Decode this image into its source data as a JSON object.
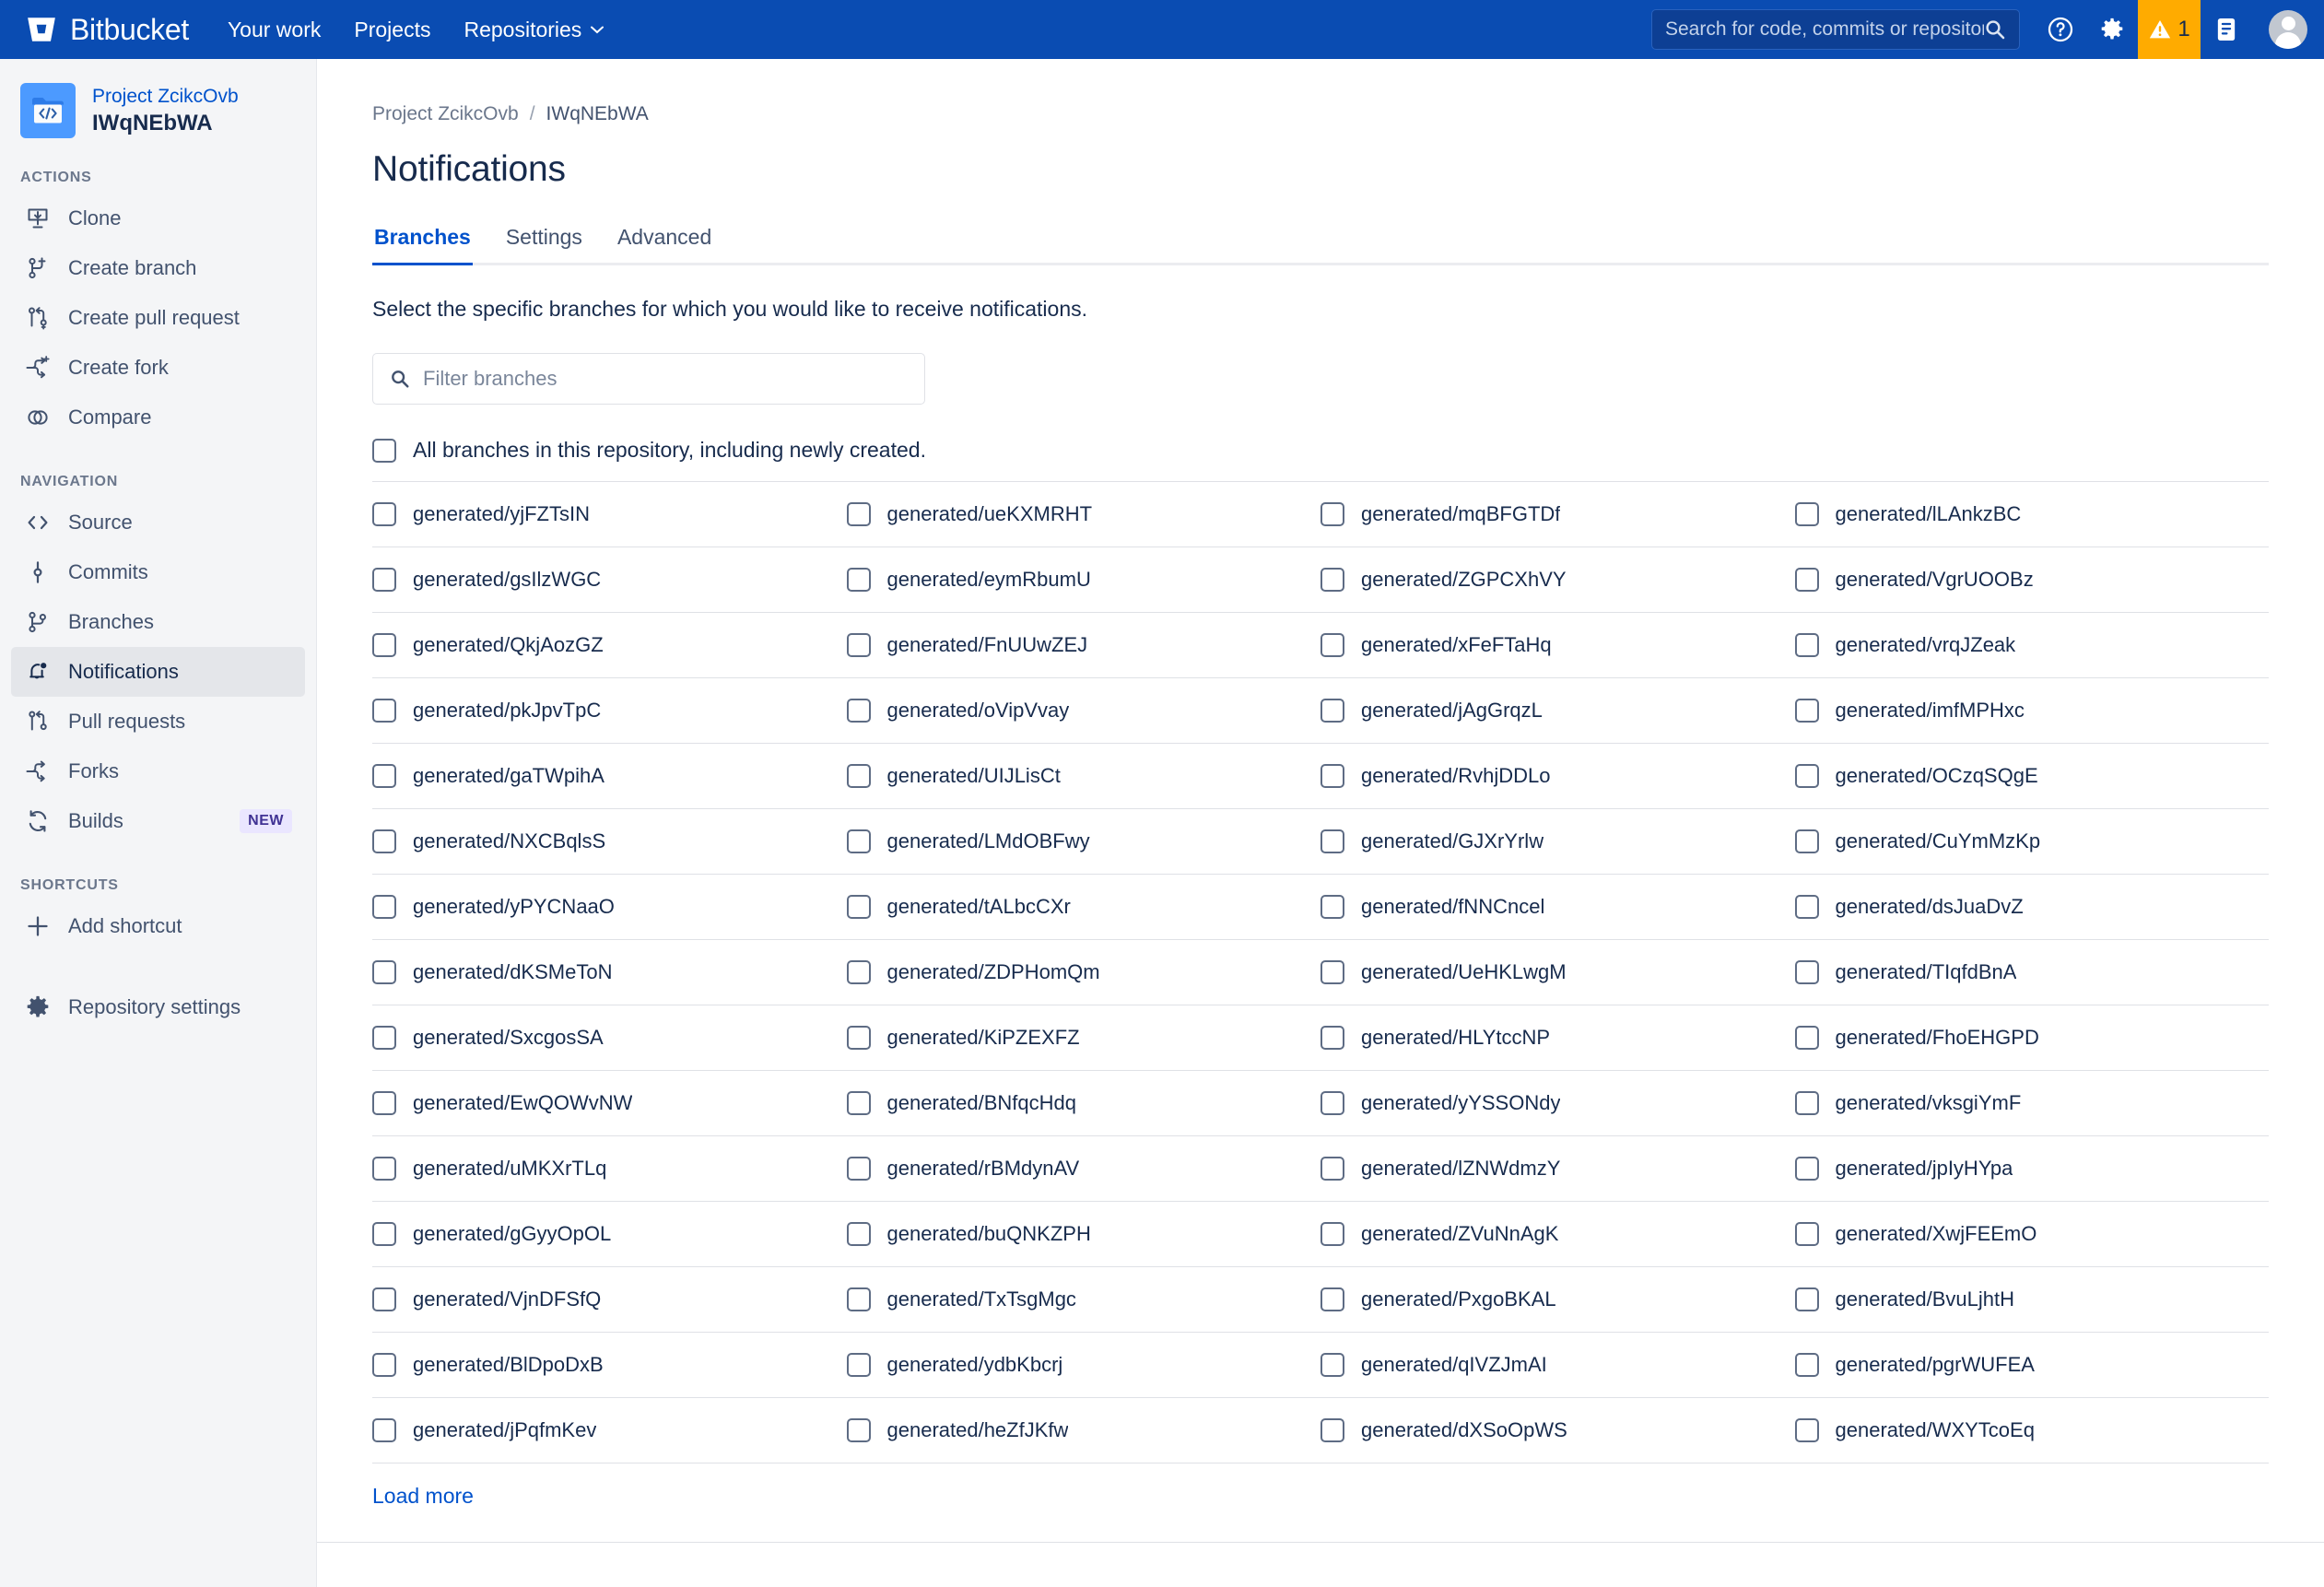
{
  "topnav": {
    "brand": "Bitbucket",
    "links": [
      {
        "label": "Your work",
        "has_chevron": false
      },
      {
        "label": "Projects",
        "has_chevron": false
      },
      {
        "label": "Repositories",
        "has_chevron": true
      }
    ],
    "search_placeholder": "Search for code, commits or repositories...",
    "notification_count": "1",
    "icons": [
      "search-icon",
      "help-icon",
      "gear-icon",
      "warning-icon",
      "notepad-icon",
      "avatar"
    ],
    "colors": {
      "bar": "#0A4CB2",
      "warning_badge": "#FFAB00"
    }
  },
  "sidebar": {
    "project_link": "Project ZcikcOvb",
    "repo_name": "IWqNEbWA",
    "sections": [
      {
        "label": "ACTIONS",
        "items": [
          {
            "label": "Clone",
            "icon": "clone-icon"
          },
          {
            "label": "Create branch",
            "icon": "create-branch-icon"
          },
          {
            "label": "Create pull request",
            "icon": "create-pull-request-icon"
          },
          {
            "label": "Create fork",
            "icon": "create-fork-icon"
          },
          {
            "label": "Compare",
            "icon": "compare-icon"
          }
        ]
      },
      {
        "label": "NAVIGATION",
        "items": [
          {
            "label": "Source",
            "icon": "source-icon"
          },
          {
            "label": "Commits",
            "icon": "commits-icon"
          },
          {
            "label": "Branches",
            "icon": "branches-icon"
          },
          {
            "label": "Notifications",
            "icon": "notifications-icon",
            "active": true
          },
          {
            "label": "Pull requests",
            "icon": "pull-requests-icon"
          },
          {
            "label": "Forks",
            "icon": "forks-icon"
          },
          {
            "label": "Builds",
            "icon": "builds-icon",
            "badge": "NEW"
          }
        ]
      },
      {
        "label": "SHORTCUTS",
        "items": [
          {
            "label": "Add shortcut",
            "icon": "plus-icon"
          }
        ]
      }
    ],
    "repository_settings": {
      "label": "Repository settings",
      "icon": "gear-icon"
    }
  },
  "main": {
    "breadcrumb": {
      "project": "Project ZcikcOvb",
      "separator": "/",
      "repo": "IWqNEbWA"
    },
    "title": "Notifications",
    "tabs": [
      {
        "label": "Branches",
        "active": true
      },
      {
        "label": "Settings",
        "active": false
      },
      {
        "label": "Advanced",
        "active": false
      }
    ],
    "lead": "Select the specific branches for which you would like to receive notifications.",
    "filter_placeholder": "Filter branches",
    "filter_value": "",
    "all_branches_label": "All branches in this repository, including newly created.",
    "all_branches_checked": false,
    "load_more_label": "Load more",
    "branches": [
      "generated/yjFZTsIN",
      "generated/ueKXMRHT",
      "generated/mqBFGTDf",
      "generated/lLAnkzBC",
      "generated/gsIlzWGC",
      "generated/eymRbumU",
      "generated/ZGPCXhVY",
      "generated/VgrUOOBz",
      "generated/QkjAozGZ",
      "generated/FnUUwZEJ",
      "generated/xFeFTaHq",
      "generated/vrqJZeak",
      "generated/pkJpvTpC",
      "generated/oVipVvay",
      "generated/jAgGrqzL",
      "generated/imfMPHxc",
      "generated/gaTWpihA",
      "generated/UIJLisCt",
      "generated/RvhjDDLo",
      "generated/OCzqSQgE",
      "generated/NXCBqlsS",
      "generated/LMdOBFwy",
      "generated/GJXrYrlw",
      "generated/CuYmMzKp",
      "generated/yPYCNaaO",
      "generated/tALbcCXr",
      "generated/fNNCncel",
      "generated/dsJuaDvZ",
      "generated/dKSMeToN",
      "generated/ZDPHomQm",
      "generated/UeHKLwgM",
      "generated/TIqfdBnA",
      "generated/SxcgosSA",
      "generated/KiPZEXFZ",
      "generated/HLYtccNP",
      "generated/FhoEHGPD",
      "generated/EwQOWvNW",
      "generated/BNfqcHdq",
      "generated/yYSSONdy",
      "generated/vksgiYmF",
      "generated/uMKXrTLq",
      "generated/rBMdynAV",
      "generated/lZNWdmzY",
      "generated/jpIyHYpa",
      "generated/gGyyOpOL",
      "generated/buQNKZPH",
      "generated/ZVuNnAgK",
      "generated/XwjFEEmO",
      "generated/VjnDFSfQ",
      "generated/TxTsgMgc",
      "generated/PxgoBKAL",
      "generated/BvuLjhtH",
      "generated/BlDpoDxB",
      "generated/ydbKbcrj",
      "generated/qIVZJmAI",
      "generated/pgrWUFEA",
      "generated/jPqfmKev",
      "generated/heZfJKfw",
      "generated/dXSoOpWS",
      "generated/WXYTcoEq"
    ]
  }
}
